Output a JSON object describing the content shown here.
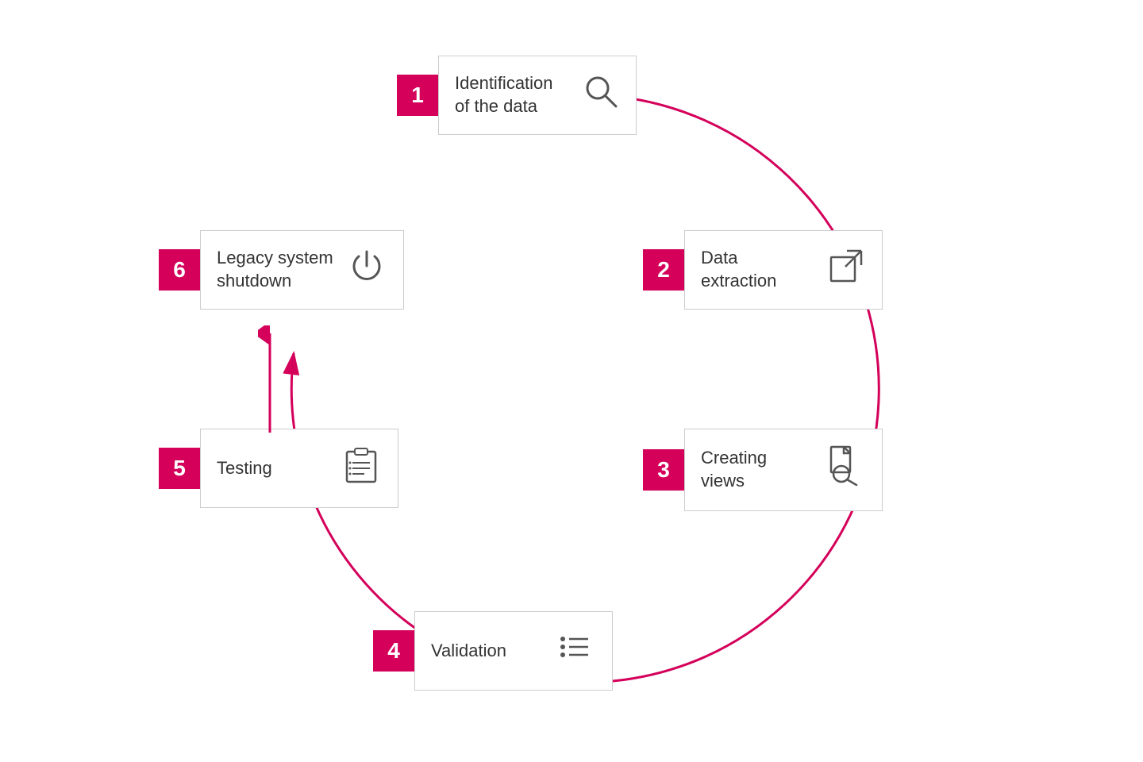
{
  "steps": [
    {
      "id": "step-1",
      "number": "1",
      "label": "Identification\nof the data",
      "icon": "search"
    },
    {
      "id": "step-2",
      "number": "2",
      "label": "Data\nextraction",
      "icon": "export"
    },
    {
      "id": "step-3",
      "number": "3",
      "label": "Creating\nviews",
      "icon": "file-search"
    },
    {
      "id": "step-4",
      "number": "4",
      "label": "Validation",
      "icon": "list"
    },
    {
      "id": "step-5",
      "number": "5",
      "label": "Testing",
      "icon": "clipboard"
    },
    {
      "id": "step-6",
      "number": "6",
      "label": "Legacy system\nshutdown",
      "icon": "power"
    }
  ],
  "accent_color": "#d4005a",
  "icon_color": "#555"
}
